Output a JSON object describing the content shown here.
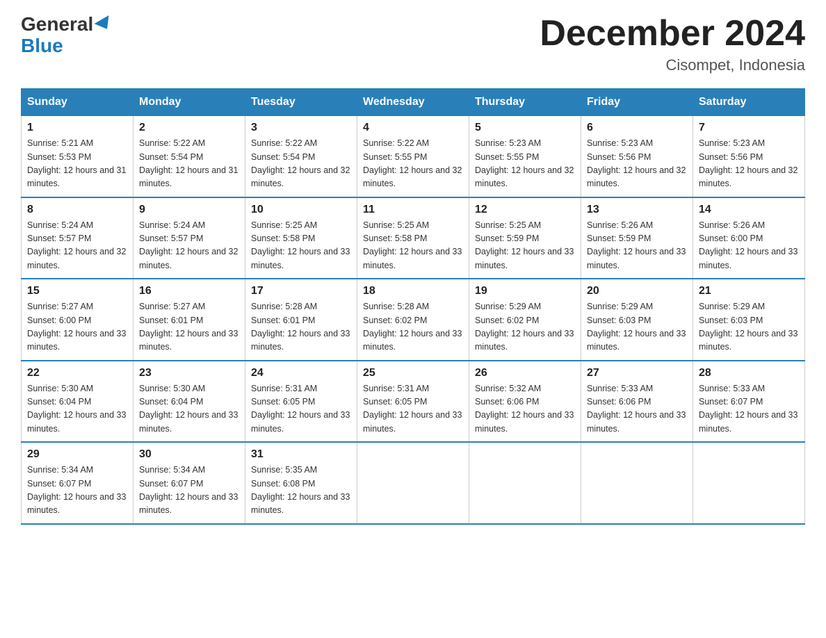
{
  "logo": {
    "general": "General",
    "blue": "Blue"
  },
  "title": "December 2024",
  "location": "Cisompet, Indonesia",
  "weekdays": [
    "Sunday",
    "Monday",
    "Tuesday",
    "Wednesday",
    "Thursday",
    "Friday",
    "Saturday"
  ],
  "weeks": [
    [
      {
        "day": "1",
        "sunrise": "5:21 AM",
        "sunset": "5:53 PM",
        "daylight": "12 hours and 31 minutes."
      },
      {
        "day": "2",
        "sunrise": "5:22 AM",
        "sunset": "5:54 PM",
        "daylight": "12 hours and 31 minutes."
      },
      {
        "day": "3",
        "sunrise": "5:22 AM",
        "sunset": "5:54 PM",
        "daylight": "12 hours and 32 minutes."
      },
      {
        "day": "4",
        "sunrise": "5:22 AM",
        "sunset": "5:55 PM",
        "daylight": "12 hours and 32 minutes."
      },
      {
        "day": "5",
        "sunrise": "5:23 AM",
        "sunset": "5:55 PM",
        "daylight": "12 hours and 32 minutes."
      },
      {
        "day": "6",
        "sunrise": "5:23 AM",
        "sunset": "5:56 PM",
        "daylight": "12 hours and 32 minutes."
      },
      {
        "day": "7",
        "sunrise": "5:23 AM",
        "sunset": "5:56 PM",
        "daylight": "12 hours and 32 minutes."
      }
    ],
    [
      {
        "day": "8",
        "sunrise": "5:24 AM",
        "sunset": "5:57 PM",
        "daylight": "12 hours and 32 minutes."
      },
      {
        "day": "9",
        "sunrise": "5:24 AM",
        "sunset": "5:57 PM",
        "daylight": "12 hours and 32 minutes."
      },
      {
        "day": "10",
        "sunrise": "5:25 AM",
        "sunset": "5:58 PM",
        "daylight": "12 hours and 33 minutes."
      },
      {
        "day": "11",
        "sunrise": "5:25 AM",
        "sunset": "5:58 PM",
        "daylight": "12 hours and 33 minutes."
      },
      {
        "day": "12",
        "sunrise": "5:25 AM",
        "sunset": "5:59 PM",
        "daylight": "12 hours and 33 minutes."
      },
      {
        "day": "13",
        "sunrise": "5:26 AM",
        "sunset": "5:59 PM",
        "daylight": "12 hours and 33 minutes."
      },
      {
        "day": "14",
        "sunrise": "5:26 AM",
        "sunset": "6:00 PM",
        "daylight": "12 hours and 33 minutes."
      }
    ],
    [
      {
        "day": "15",
        "sunrise": "5:27 AM",
        "sunset": "6:00 PM",
        "daylight": "12 hours and 33 minutes."
      },
      {
        "day": "16",
        "sunrise": "5:27 AM",
        "sunset": "6:01 PM",
        "daylight": "12 hours and 33 minutes."
      },
      {
        "day": "17",
        "sunrise": "5:28 AM",
        "sunset": "6:01 PM",
        "daylight": "12 hours and 33 minutes."
      },
      {
        "day": "18",
        "sunrise": "5:28 AM",
        "sunset": "6:02 PM",
        "daylight": "12 hours and 33 minutes."
      },
      {
        "day": "19",
        "sunrise": "5:29 AM",
        "sunset": "6:02 PM",
        "daylight": "12 hours and 33 minutes."
      },
      {
        "day": "20",
        "sunrise": "5:29 AM",
        "sunset": "6:03 PM",
        "daylight": "12 hours and 33 minutes."
      },
      {
        "day": "21",
        "sunrise": "5:29 AM",
        "sunset": "6:03 PM",
        "daylight": "12 hours and 33 minutes."
      }
    ],
    [
      {
        "day": "22",
        "sunrise": "5:30 AM",
        "sunset": "6:04 PM",
        "daylight": "12 hours and 33 minutes."
      },
      {
        "day": "23",
        "sunrise": "5:30 AM",
        "sunset": "6:04 PM",
        "daylight": "12 hours and 33 minutes."
      },
      {
        "day": "24",
        "sunrise": "5:31 AM",
        "sunset": "6:05 PM",
        "daylight": "12 hours and 33 minutes."
      },
      {
        "day": "25",
        "sunrise": "5:31 AM",
        "sunset": "6:05 PM",
        "daylight": "12 hours and 33 minutes."
      },
      {
        "day": "26",
        "sunrise": "5:32 AM",
        "sunset": "6:06 PM",
        "daylight": "12 hours and 33 minutes."
      },
      {
        "day": "27",
        "sunrise": "5:33 AM",
        "sunset": "6:06 PM",
        "daylight": "12 hours and 33 minutes."
      },
      {
        "day": "28",
        "sunrise": "5:33 AM",
        "sunset": "6:07 PM",
        "daylight": "12 hours and 33 minutes."
      }
    ],
    [
      {
        "day": "29",
        "sunrise": "5:34 AM",
        "sunset": "6:07 PM",
        "daylight": "12 hours and 33 minutes."
      },
      {
        "day": "30",
        "sunrise": "5:34 AM",
        "sunset": "6:07 PM",
        "daylight": "12 hours and 33 minutes."
      },
      {
        "day": "31",
        "sunrise": "5:35 AM",
        "sunset": "6:08 PM",
        "daylight": "12 hours and 33 minutes."
      },
      null,
      null,
      null,
      null
    ]
  ]
}
